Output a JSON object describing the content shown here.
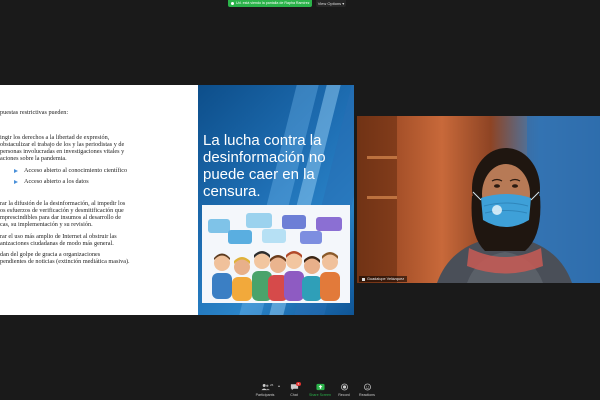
{
  "banner": {
    "share_status": "Ud. está viendo la pantalla de Rapha Ramírez",
    "view_options": "View Options"
  },
  "slide": {
    "heading": "puestas restrictivas pueden:",
    "lines": [
      "ingir los derechos a la libertad de expresión,",
      "obstaculizar el trabajo de los y las periodistas y de",
      " personas involucradas en investigaciones vitales y",
      "aciones sobre la pandemia."
    ],
    "bullets": [
      "Acceso abierto al conocimiento científico",
      "Acceso abierto a los datos"
    ],
    "para2": [
      "rar la difusión de la desinformación, al impedir los",
      "os esfuerzos de verificación y desmitificación que",
      "mprescindibles para dar insumos al desarrollo de",
      "cas, su implementación y su revisión."
    ],
    "para3": [
      "rar el uso más amplio de Internet al obstruir las",
      "anizaciones ciudadanas de modo más general."
    ],
    "para4": [
      "dan del golpe de gracia a organizaciones",
      "pendientes de noticias (extinción mediática masiva)."
    ],
    "title": "La lucha contra la desinformación no puede caer en la censura."
  },
  "camera": {
    "participant_name": "Guadalupe Velázquez"
  },
  "toolbar": {
    "participants_label": "Participants",
    "participants_count": "26",
    "chat_label": "Chat",
    "chat_badge": "5",
    "share_label": "Share Screen",
    "record_label": "Record",
    "reactions_label": "Reactions"
  },
  "colors": {
    "share_green": "#2bb34a",
    "slide_blue": "#1f6fb4",
    "bullet_blue": "#4a90d9",
    "mask_blue": "#3ea0d8",
    "badge_red": "#e0312f"
  }
}
